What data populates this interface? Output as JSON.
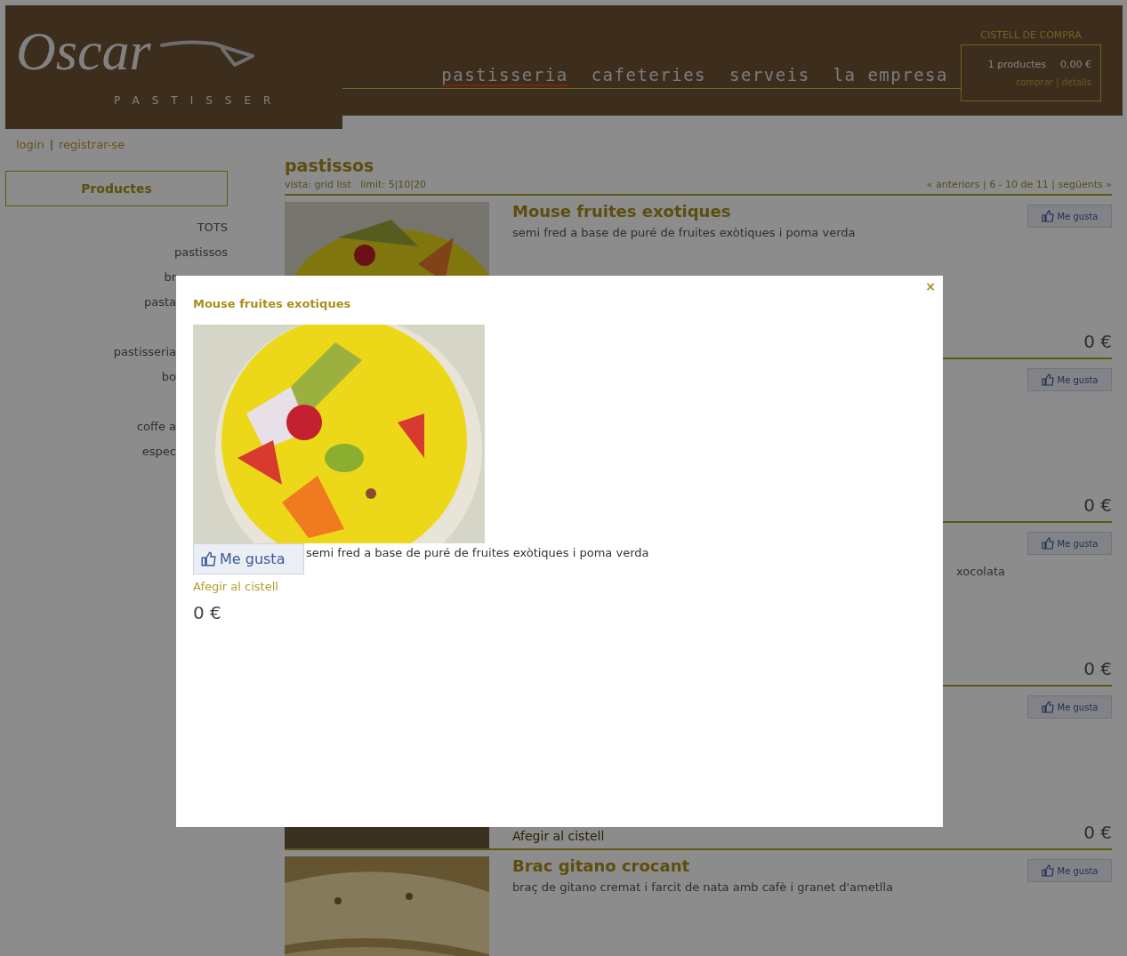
{
  "header": {
    "logo": "Oscar",
    "tagline": "PASTISSER",
    "nav": [
      {
        "label": "pastisseria",
        "selected": true
      },
      {
        "label": "cafeteries",
        "selected": false
      },
      {
        "label": "serveis",
        "selected": false
      },
      {
        "label": "la empresa",
        "selected": false
      }
    ],
    "cart": {
      "title": "CISTELL DE COMPRA",
      "count": "1 productes",
      "total": "0,00 €",
      "links": "comprar | detalls"
    }
  },
  "account": {
    "links": [
      "login",
      "registrar-se"
    ],
    "separator": "|"
  },
  "sidebar": {
    "heading": "Productes",
    "items": [
      "TOTS",
      "pastissos"
    ],
    "partly_hidden_groups": [
      [
        "br",
        "pasta"
      ],
      [
        "pastisseria",
        "bo"
      ],
      [
        "coffe a",
        "espec"
      ]
    ]
  },
  "content": {
    "heading": "pastissos",
    "view_options": "vista: grid list   limit: 5|10|20",
    "pagination": "« anteriors | 6 - 10 de 11 | següents »",
    "products": [
      {
        "title": "Mouse fruites exotiques",
        "description": "semi fred a base de puré de fruites exòtiques i poma verda",
        "like": "Me gusta",
        "price": "0 €"
      },
      {
        "like": "Me gusta",
        "price": "0 €"
      },
      {
        "description": "xocolata",
        "description_cut": true,
        "like": "Me gusta",
        "price": "0 €"
      },
      {
        "add_to_cart": "Afegir al cistell",
        "like": "Me gusta",
        "price": "0 €"
      },
      {
        "title": "Brac gitano crocant",
        "description": "braç de gitano cremat i farcit de nata amb cafè i granet d'ametlla",
        "like": "Me gusta"
      }
    ]
  },
  "modal": {
    "title": "Mouse fruites exotiques",
    "close": "×",
    "like": "Me gusta",
    "description": "semi fred a base de puré de fruites exòtiques i poma verda",
    "add_to_cart": "Afegir al cistell",
    "price": "0 €"
  }
}
